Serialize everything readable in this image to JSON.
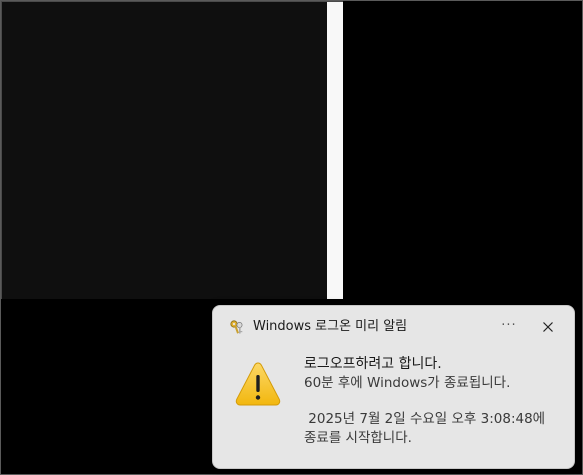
{
  "toast": {
    "app_name": "Windows 로그온 미리 알림",
    "more_label": "···",
    "title": "로그오프하려고 합니다.",
    "line1": "60분 후에 Windows가 종료됩니다.",
    "line2": " 2025년 7월 2일 수요일 오후 3:08:48에",
    "line3": "종료를 시작합니다.",
    "icons": {
      "app": "keys-icon",
      "warning": "warning-icon",
      "close": "close-icon"
    }
  },
  "colors": {
    "desktop_bg": "#000000",
    "toast_bg": "#e6e6e6",
    "warning_fill": "#f7c948",
    "window_content": "#0f0f0f"
  }
}
